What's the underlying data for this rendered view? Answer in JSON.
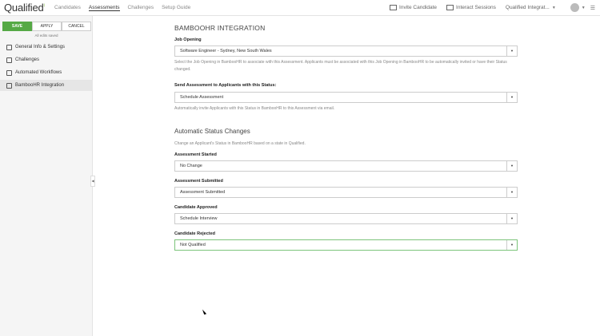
{
  "app": {
    "logo": "Qualified",
    "logo_mark": "i"
  },
  "nav": [
    "Candidates",
    "Assessments",
    "Challenges",
    "Setup Guide"
  ],
  "topright": {
    "invite": "Invite Candidate",
    "interact": "Interact Sessions",
    "org": "Qualified Integrat..."
  },
  "sidebar": {
    "save": "SAVE",
    "apply": "APPLY",
    "cancel": "CANCEL",
    "saved_status": "All edits saved",
    "items": [
      "General Info & Settings",
      "Challenges",
      "Automated Workflows",
      "BambooHR Integration"
    ]
  },
  "main": {
    "title": "BAMBOOHR INTEGRATION",
    "job_opening_label": "Job Opening",
    "job_opening_value": "Software Engineer - Sydney, New South Wales",
    "job_opening_help": "Select the Job Opening in BambooHR to associate with this Assessment. Applicants must be associated with this Job Opening in BambooHR to be automatically invited or have their Status changed.",
    "send_label": "Send Assessment to Applicants with this Status:",
    "send_value": "Schedule Assessment",
    "send_help": "Automatically invite Applicants with this Status in BambooHR to this Assessment via email.",
    "status_title": "Automatic Status Changes",
    "status_help": "Change an Applicant's Status in BambooHR based on a state in Qualified.",
    "started_label": "Assessment Started",
    "started_value": "No Change",
    "submitted_label": "Assessment Submitted",
    "submitted_value": "Assessment Submitted",
    "approved_label": "Candidate Approved",
    "approved_value": "Schedule Interview",
    "rejected_label": "Candidate Rejected",
    "rejected_value": "Not Qualified"
  }
}
